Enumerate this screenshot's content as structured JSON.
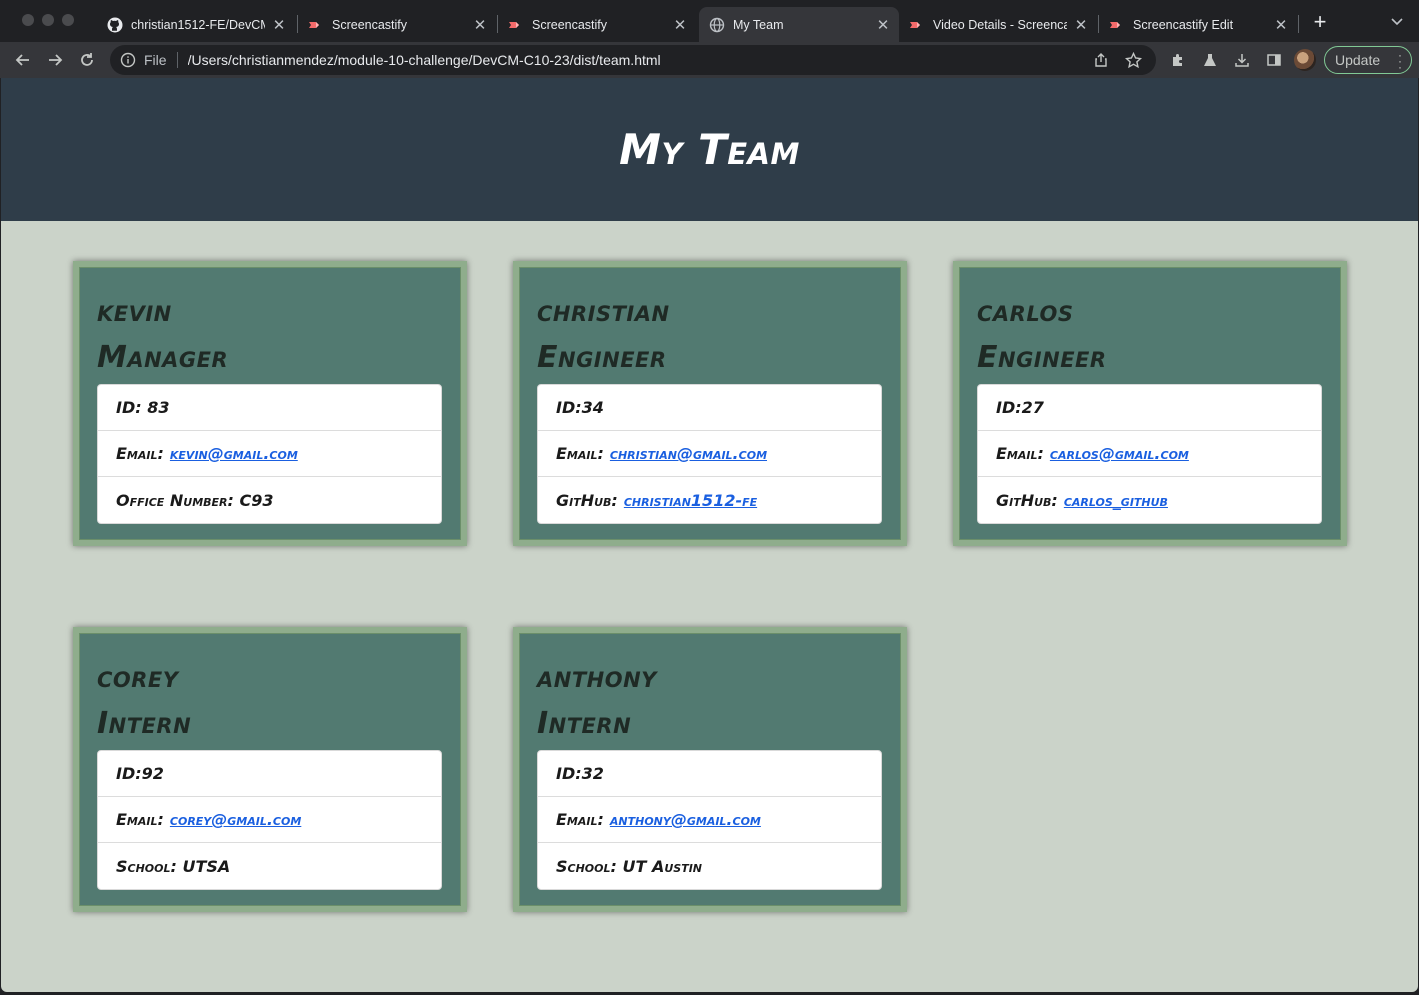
{
  "browser": {
    "tabs": [
      {
        "title": "christian1512-FE/DevCM",
        "icon": "github-icon",
        "active": false
      },
      {
        "title": "Screencastify",
        "icon": "screencastify-icon",
        "active": false
      },
      {
        "title": "Screencastify",
        "icon": "screencastify-icon",
        "active": false
      },
      {
        "title": "My Team",
        "icon": "globe-icon",
        "active": true
      },
      {
        "title": "Video Details - Screenca",
        "icon": "screencastify-icon",
        "active": false
      },
      {
        "title": "Screencastify Edit",
        "icon": "screencastify-icon",
        "active": false
      }
    ],
    "address": {
      "scheme": "File",
      "url": "/Users/christianmendez/module-10-challenge/DevCM-C10-23/dist/team.html"
    },
    "update_label": "Update",
    "colors": {
      "chrome_dark": "#202124",
      "toolbar": "#35363a",
      "update_border": "#81c995"
    }
  },
  "page": {
    "title": "My Team",
    "colors": {
      "header_bg": "#2f3d49",
      "page_bg": "#cbd3c9",
      "card_bg": "#527a71",
      "card_border": "#8fad8c",
      "link": "#1a5fe0"
    },
    "employees": [
      {
        "name": "kevin",
        "role": "Manager",
        "id_line": "ID: 83",
        "email_label": "Email:",
        "email": "kevin@gmail.com",
        "extra_label": "Office Number:",
        "extra_value": "C93",
        "extra_is_link": false
      },
      {
        "name": "christian",
        "role": "Engineer",
        "id_line": "ID:34",
        "email_label": "Email:",
        "email": "christian@gmail.com",
        "extra_label": "GitHub:",
        "extra_value": "christian1512-FE",
        "extra_is_link": true
      },
      {
        "name": "carlos",
        "role": "Engineer",
        "id_line": "ID:27",
        "email_label": "Email:",
        "email": "carlos@gmail.com",
        "extra_label": "GitHub:",
        "extra_value": "carlos_github",
        "extra_is_link": true
      },
      {
        "name": "corey",
        "role": "Intern",
        "id_line": "ID:92",
        "email_label": "Email:",
        "email": "corey@gmail.com",
        "extra_label": "School:",
        "extra_value": "UTSA",
        "extra_is_link": false
      },
      {
        "name": "anthony",
        "role": "Intern",
        "id_line": "ID:32",
        "email_label": "Email:",
        "email": "anthony@gmail.com",
        "extra_label": "School:",
        "extra_value": "UT Austin",
        "extra_is_link": false
      }
    ]
  }
}
